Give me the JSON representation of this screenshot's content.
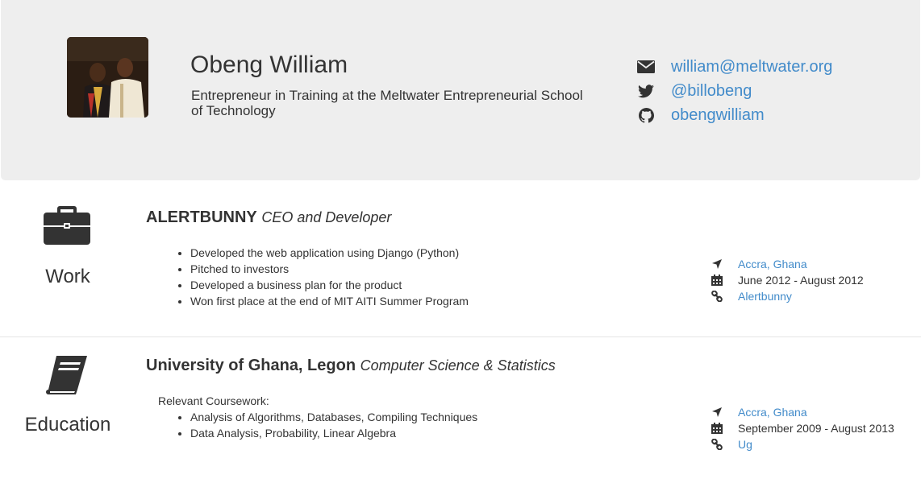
{
  "profile": {
    "name": "Obeng William",
    "tagline": "Entrepreneur in Training at the Meltwater Entrepreneurial School of Technology",
    "contacts": {
      "email": "william@meltwater.org",
      "twitter": "@billobeng",
      "github": "obengwilliam"
    }
  },
  "work": {
    "section_label": "Work",
    "company": "ALERTBUNNY",
    "role": "CEO and Developer",
    "bullets": [
      "Developed the web application using Django (Python)",
      "Pitched to investors",
      "Developed a business plan for the product",
      "Won first place at the end of MIT AITI Summer Program"
    ],
    "location": "Accra, Ghana",
    "dates": "June 2012 - August 2012",
    "link": "Alertbunny"
  },
  "education": {
    "section_label": "Education",
    "school": "University of Ghana, Legon",
    "program": "Computer Science & Statistics",
    "coursework_label": "Relevant Coursework:",
    "bullets": [
      "Analysis of Algorithms, Databases, Compiling Techniques",
      "Data Analysis, Probability, Linear Algebra"
    ],
    "location": "Accra, Ghana",
    "dates": "September 2009 - August 2013",
    "link": "Ug"
  },
  "colors": {
    "link": "#428bca",
    "header_bg": "#eeeeee",
    "text": "#333333"
  },
  "icons": [
    "envelope-icon",
    "twitter-icon",
    "github-icon",
    "briefcase-icon",
    "book-icon",
    "location-arrow-icon",
    "calendar-icon",
    "link-icon"
  ]
}
